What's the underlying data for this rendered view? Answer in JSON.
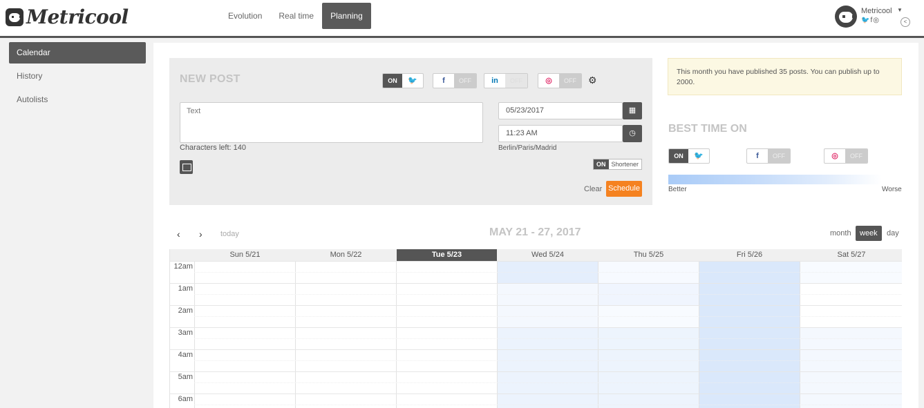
{
  "app": {
    "logo_text": "Metricool",
    "nav": [
      {
        "label": "Evolution",
        "active": false
      },
      {
        "label": "Real time",
        "active": false
      },
      {
        "label": "Planning",
        "active": true
      }
    ],
    "account": {
      "name": "Metricool",
      "social_icons": "🐦 f ◎"
    }
  },
  "sidebar": {
    "items": [
      {
        "label": "Calendar",
        "active": true
      },
      {
        "label": "History",
        "active": false
      },
      {
        "label": "Autolists",
        "active": false
      }
    ]
  },
  "new_post": {
    "title": "NEW POST",
    "toggles": [
      {
        "network": "twitter",
        "icon": "t",
        "state": "ON",
        "color": "#1da1f2"
      },
      {
        "network": "facebook",
        "icon": "f",
        "state": "OFF",
        "color": "#3b5998"
      },
      {
        "network": "linkedin",
        "icon": "in",
        "state": "OFF",
        "color": "#0077b5"
      },
      {
        "network": "instagram",
        "icon": "◎",
        "state": "OFF",
        "color": "#e1306c"
      }
    ],
    "text_placeholder": "Text",
    "chars_left": "Characters left: 140",
    "date_value": "05/23/2017",
    "time_value": "11:23 AM",
    "timezone": "Berlin/Paris/Madrid",
    "shortener_on": "ON",
    "shortener_label": "Shortener",
    "clear_label": "Clear",
    "schedule_label": "Schedule",
    "schedule_color": "#f58220"
  },
  "notice": {
    "text": "This month you have published 35 posts. You can publish up to 2000."
  },
  "best_time": {
    "title": "BEST TIME ON",
    "toggles": [
      {
        "network": "twitter",
        "icon": "t",
        "state": "ON"
      },
      {
        "network": "facebook",
        "icon": "f",
        "state": "OFF"
      },
      {
        "network": "instagram",
        "icon": "◎",
        "state": "OFF"
      }
    ],
    "better_label": "Better",
    "worse_label": "Worse"
  },
  "calendar": {
    "prev_icon": "‹",
    "next_icon": "›",
    "today_label": "today",
    "range_title": "MAY 21 - 27, 2017",
    "views": [
      {
        "label": "month",
        "active": false
      },
      {
        "label": "week",
        "active": true
      },
      {
        "label": "day",
        "active": false
      }
    ],
    "days": [
      {
        "label": "Sun 5/21",
        "today": false
      },
      {
        "label": "Mon 5/22",
        "today": false
      },
      {
        "label": "Tue 5/23",
        "today": true
      },
      {
        "label": "Wed 5/24",
        "today": false
      },
      {
        "label": "Thu 5/25",
        "today": false
      },
      {
        "label": "Fri 5/26",
        "today": false
      },
      {
        "label": "Sat 5/27",
        "today": false
      }
    ],
    "hours": [
      "12am",
      "1am",
      "2am",
      "3am",
      "4am",
      "5am",
      "6am"
    ]
  }
}
